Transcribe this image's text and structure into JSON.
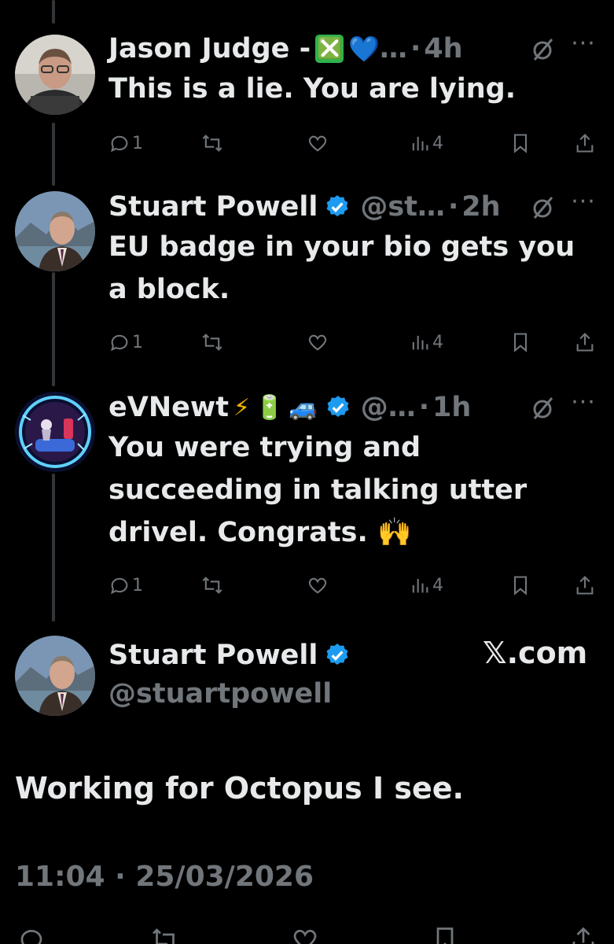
{
  "tweets": [
    {
      "name": "Jason Judge - ",
      "emojis": [
        "❎",
        "💙"
      ],
      "handle": "…",
      "dot": "·",
      "time": "4h",
      "text": "This is a lie. You are lying.",
      "replies": "1",
      "views": "4"
    },
    {
      "name": "Stuart Powell",
      "handle": "@st…",
      "dot": "·",
      "time": "2h",
      "text": "EU badge in your bio gets you a block.",
      "replies": "1",
      "views": "4"
    },
    {
      "name": "eVNewt",
      "emojis": [
        "⚡",
        "🔋",
        "🚙"
      ],
      "handle": "@…",
      "dot": "·",
      "time": "1h",
      "text": "You were trying and succeeding in talking utter drivel. Congrats. 🙌",
      "replies": "1",
      "views": "4"
    }
  ],
  "quote": {
    "name": "Stuart Powell",
    "handle": "@stuartpowell",
    "source": "𝕏.com",
    "text": "Working for Octopus I see.",
    "datetime": "11:04 · 25/03/2026"
  },
  "colors": {
    "background": "#000000",
    "text": "#e7e9ea",
    "muted": "#71767b",
    "verified": "#1d9bf0"
  },
  "icons": [
    "reply-icon",
    "retweet-icon",
    "like-icon",
    "views-icon",
    "bookmark-icon",
    "share-icon",
    "grok-icon",
    "more-icon",
    "verified-badge-icon"
  ]
}
